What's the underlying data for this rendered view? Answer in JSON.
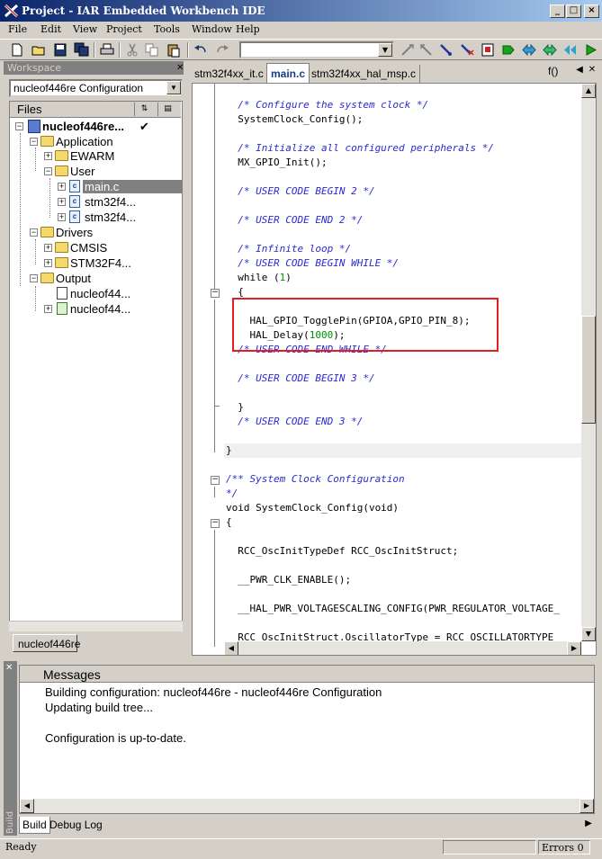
{
  "window": {
    "title": "Project - IAR Embedded Workbench IDE"
  },
  "menu": [
    "File",
    "Edit",
    "View",
    "Project",
    "Tools",
    "Window",
    "Help"
  ],
  "toolbar": {
    "combo_value": ""
  },
  "workspace": {
    "title": "Workspace",
    "configuration": "nucleof446re Configuration",
    "files_header": "Files",
    "tree": [
      {
        "label": "nucleof446re...",
        "bold": true,
        "check": "✔"
      },
      {
        "label": "Application"
      },
      {
        "label": "EWARM"
      },
      {
        "label": "User"
      },
      {
        "label": "main.c",
        "selected": true
      },
      {
        "label": "stm32f4..."
      },
      {
        "label": "stm32f4..."
      },
      {
        "label": "Drivers"
      },
      {
        "label": "CMSIS"
      },
      {
        "label": "STM32F4..."
      },
      {
        "label": "Output"
      },
      {
        "label": "nucleof44..."
      },
      {
        "label": "nucleof44..."
      }
    ],
    "tab": "nucleof446re"
  },
  "editor": {
    "tabs": [
      "stm32f4xx_it.c",
      "main.c",
      "stm32f4xx_hal_msp.c"
    ],
    "active_tab": "main.c",
    "function_combo": "f()",
    "lines": [
      {
        "text": "  /* Configure the system clock */",
        "type": "comment"
      },
      {
        "text": "  SystemClock_Config();",
        "type": "code"
      },
      {
        "text": "",
        "type": "code"
      },
      {
        "text": "  /* Initialize all configured peripherals */",
        "type": "comment"
      },
      {
        "text": "  MX_GPIO_Init();",
        "type": "code"
      },
      {
        "text": "",
        "type": "code"
      },
      {
        "text": "  /* USER CODE BEGIN 2 */",
        "type": "comment"
      },
      {
        "text": "",
        "type": "code"
      },
      {
        "text": "  /* USER CODE END 2 */",
        "type": "comment"
      },
      {
        "text": "",
        "type": "code"
      },
      {
        "text": "  /* Infinite loop */",
        "type": "comment"
      },
      {
        "text": "  /* USER CODE BEGIN WHILE */",
        "type": "comment"
      },
      {
        "text": "  while (1)",
        "type": "code"
      },
      {
        "text": "  {",
        "type": "code"
      },
      {
        "text": "",
        "type": "code"
      },
      {
        "text": "    HAL_GPIO_TogglePin(GPIOA,GPIO_PIN_8);",
        "type": "code"
      },
      {
        "text": "    HAL_Delay(1000);",
        "type": "code"
      },
      {
        "text": "  /* USER CODE END WHILE */",
        "type": "comment"
      },
      {
        "text": "",
        "type": "code"
      },
      {
        "text": "  /* USER CODE BEGIN 3 */",
        "type": "comment"
      },
      {
        "text": "",
        "type": "code"
      },
      {
        "text": "  }",
        "type": "code"
      },
      {
        "text": "  /* USER CODE END 3 */",
        "type": "comment"
      },
      {
        "text": "",
        "type": "code"
      },
      {
        "text": "}",
        "type": "code"
      },
      {
        "text": "",
        "type": "code"
      },
      {
        "text": "/** System Clock Configuration",
        "type": "comment"
      },
      {
        "text": "*/",
        "type": "comment"
      },
      {
        "text": "void SystemClock_Config(void)",
        "type": "code"
      },
      {
        "text": "{",
        "type": "code"
      },
      {
        "text": "",
        "type": "code"
      },
      {
        "text": "  RCC_OscInitTypeDef RCC_OscInitStruct;",
        "type": "code"
      },
      {
        "text": "",
        "type": "code"
      },
      {
        "text": "  __PWR_CLK_ENABLE();",
        "type": "code"
      },
      {
        "text": "",
        "type": "code"
      },
      {
        "text": "  __HAL_PWR_VOLTAGESCALING_CONFIG(PWR_REGULATOR_VOLTAGE_",
        "type": "code"
      },
      {
        "text": "",
        "type": "code"
      },
      {
        "text": "  RCC_OscInitStruct.OscillatorType = RCC_OSCILLATORTYPE_",
        "type": "code"
      }
    ]
  },
  "messages": {
    "side_label": "Build",
    "header": "Messages",
    "lines": [
      "Building configuration: nucleof446re - nucleof446re Configuration",
      "Updating build tree...",
      "",
      "Configuration is up-to-date."
    ],
    "tabs": [
      "Build",
      "Debug Log"
    ]
  },
  "status": {
    "text": "Ready",
    "errors": "Errors 0"
  }
}
